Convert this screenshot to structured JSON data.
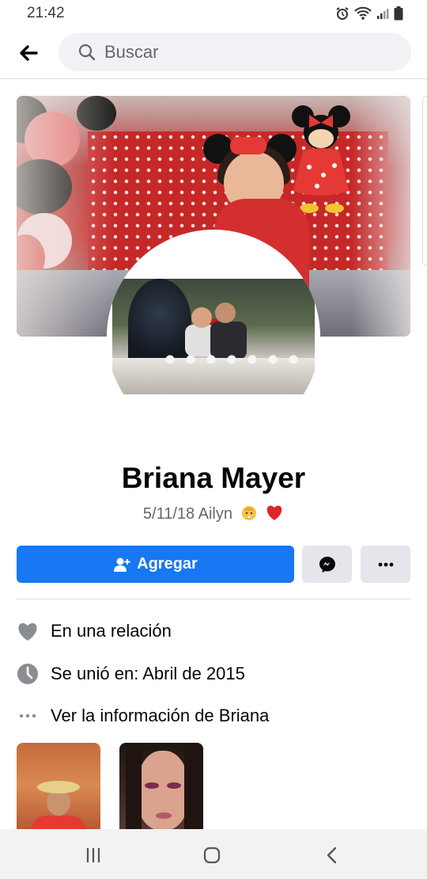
{
  "status_bar": {
    "time": "21:42",
    "icons": [
      "alarm-icon",
      "wifi-icon",
      "signal-icon",
      "battery-icon"
    ]
  },
  "header": {
    "back_icon": "arrow-left-icon",
    "search_icon": "search-icon",
    "search_placeholder": "Buscar"
  },
  "profile": {
    "name": "Briana Mayer",
    "bio": "5/11/18 Ailyn",
    "bio_emojis": [
      "baby-emoji",
      "heart-emoji"
    ]
  },
  "actions": {
    "add_label": "Agregar",
    "add_icon": "add-friend-icon",
    "message_icon": "messenger-icon",
    "more_icon": "more-dots-icon"
  },
  "details": [
    {
      "icon": "heart-icon",
      "text": "En una relación"
    },
    {
      "icon": "clock-icon",
      "text": "Se unió en: Abril de 2015"
    },
    {
      "icon": "ellipsis-icon",
      "text": "Ver la información de Briana"
    }
  ],
  "navbar": {
    "icons": [
      "recents-icon",
      "home-icon",
      "back-icon"
    ]
  },
  "colors": {
    "primary": "#1877f2",
    "secondary_button": "#e4e6eb",
    "text": "#050505",
    "muted_text": "#606770"
  }
}
